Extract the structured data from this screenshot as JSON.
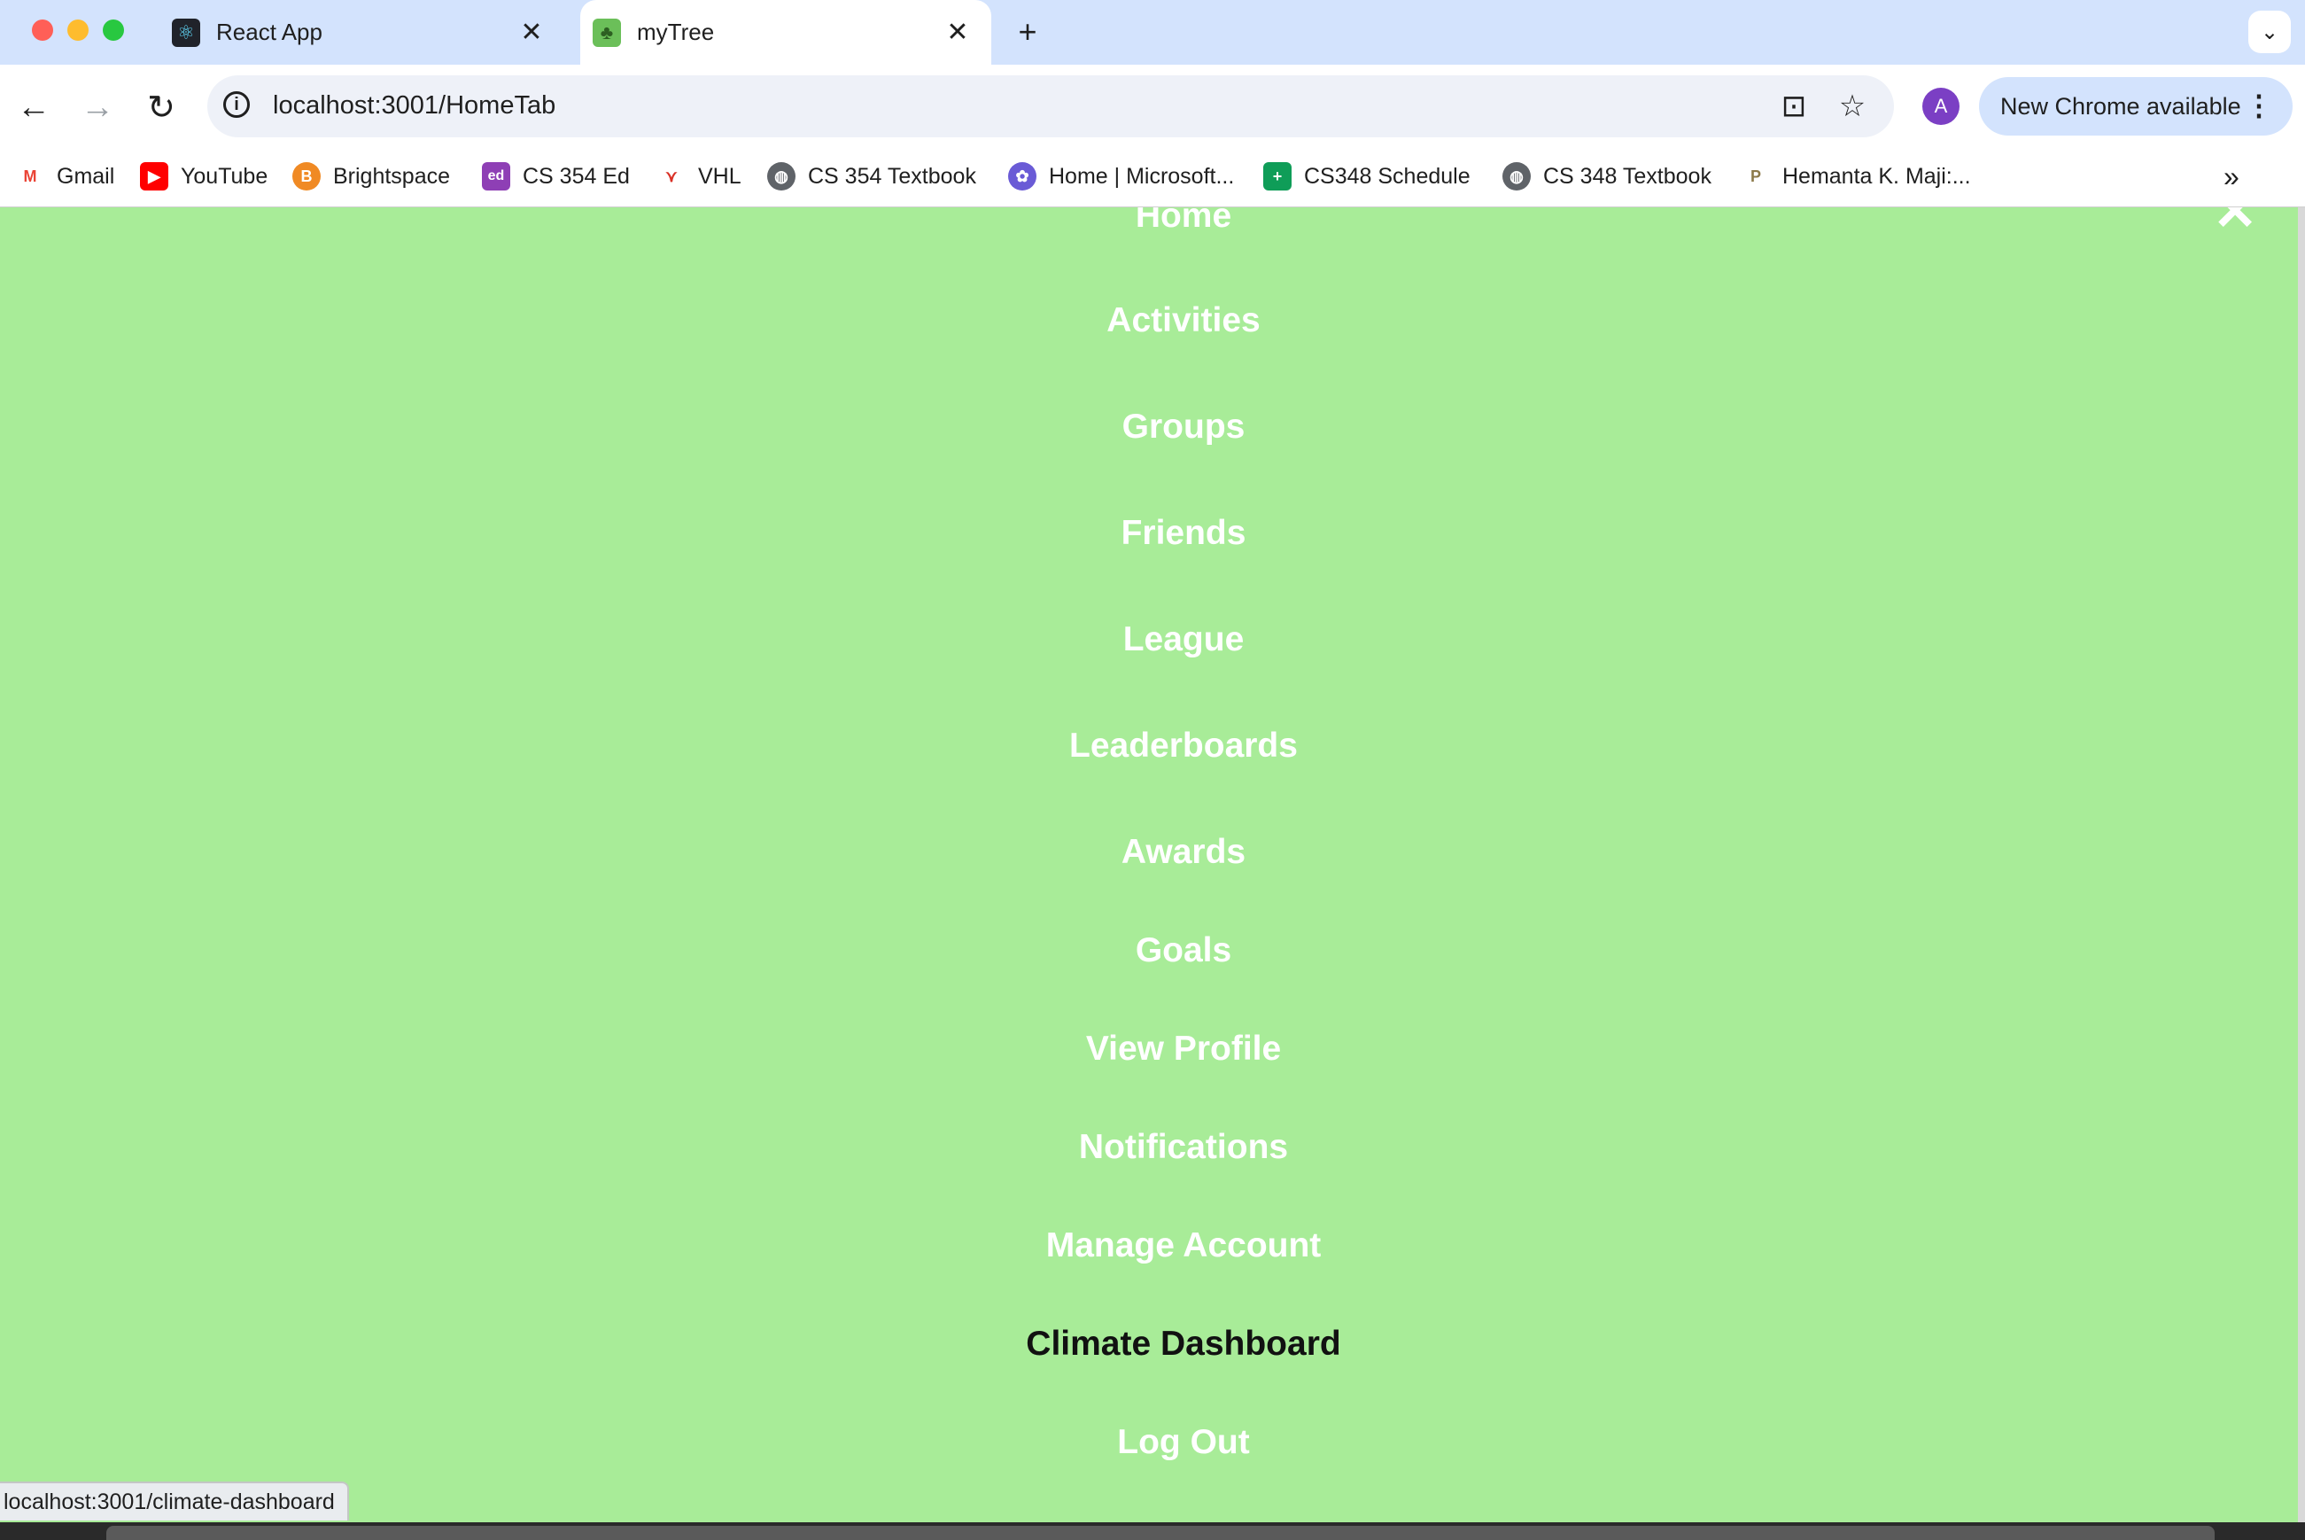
{
  "browser": {
    "tabs": [
      {
        "title": "React App",
        "icon": "react-icon",
        "active": false
      },
      {
        "title": "myTree",
        "icon": "tree-icon",
        "active": true
      }
    ],
    "url": "localhost:3001/HomeTab",
    "profile_initial": "A",
    "update_label": "New Chrome available",
    "bookmarks": [
      {
        "label": "Gmail",
        "icon": "gmail-icon",
        "color": "#ea4335"
      },
      {
        "label": "YouTube",
        "icon": "youtube-icon",
        "color": "#ff0000"
      },
      {
        "label": "Brightspace",
        "icon": "brightspace-icon",
        "color": "#f08a24"
      },
      {
        "label": "CS 354 Ed",
        "icon": "ed-icon",
        "color": "#8e3fb5"
      },
      {
        "label": "VHL",
        "icon": "vhl-icon",
        "color": "#d93025"
      },
      {
        "label": "CS 354 Textbook",
        "icon": "globe-icon",
        "color": "#5f6368"
      },
      {
        "label": "Home | Microsoft...",
        "icon": "microsoft-icon",
        "color": "#6a5bd6"
      },
      {
        "label": "CS348 Schedule",
        "icon": "sheets-icon",
        "color": "#0f9d58"
      },
      {
        "label": "CS 348 Textbook",
        "icon": "globe-icon",
        "color": "#5f6368"
      },
      {
        "label": "Hemanta K. Maji:...",
        "icon": "purdue-icon",
        "color": "#8c7a4a"
      }
    ]
  },
  "menu": {
    "items": [
      {
        "label": "Home",
        "active": false
      },
      {
        "label": "Activities",
        "active": false
      },
      {
        "label": "Groups",
        "active": false
      },
      {
        "label": "Friends",
        "active": false
      },
      {
        "label": "League",
        "active": false
      },
      {
        "label": "Leaderboards",
        "active": false
      },
      {
        "label": "Awards",
        "active": false
      },
      {
        "label": "Goals",
        "active": false
      },
      {
        "label": "View Profile",
        "active": false
      },
      {
        "label": "Notifications",
        "active": false
      },
      {
        "label": "Manage Account",
        "active": false
      },
      {
        "label": "Climate Dashboard",
        "active": true
      },
      {
        "label": "Log Out",
        "active": false
      }
    ],
    "background": "#a8ec98",
    "text_color": "#ffffff",
    "active_color": "#111111"
  },
  "status_bar": {
    "link_preview": "localhost:3001/climate-dashboard"
  }
}
